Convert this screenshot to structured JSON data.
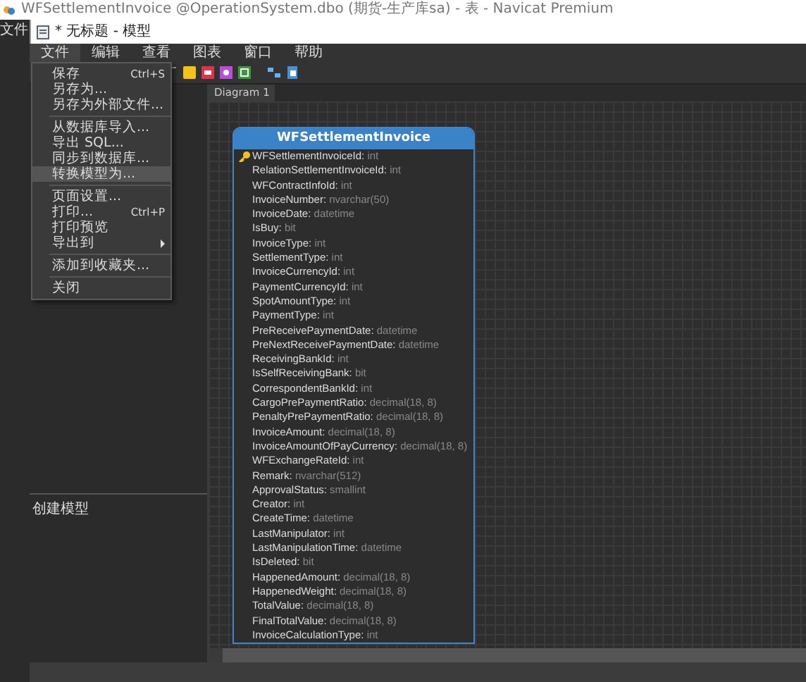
{
  "app_window": {
    "title": "WFSettlementInvoice @OperationSystem.dbo (期货-生产库sa) - 表 - Navicat Premium"
  },
  "side_strip": {
    "menu_label": "文件"
  },
  "document_window": {
    "title": "* 无标题 - 模型"
  },
  "menu_bar": [
    {
      "label": "文件",
      "selected": true
    },
    {
      "label": "编辑",
      "selected": false
    },
    {
      "label": "查看",
      "selected": false
    },
    {
      "label": "图表",
      "selected": false
    },
    {
      "label": "窗口",
      "selected": false
    },
    {
      "label": "帮助",
      "selected": false
    }
  ],
  "file_menu": [
    {
      "kind": "item",
      "label": "保存",
      "shortcut": "Ctrl+S",
      "submenu": false,
      "selected": false
    },
    {
      "kind": "item",
      "label": "另存为...",
      "submenu": false,
      "selected": false
    },
    {
      "kind": "item",
      "label": "另存为外部文件...",
      "submenu": false,
      "selected": false
    },
    {
      "kind": "separator"
    },
    {
      "kind": "item",
      "label": "从数据库导入...",
      "submenu": false,
      "selected": false
    },
    {
      "kind": "item",
      "label": "导出 SQL...",
      "submenu": false,
      "selected": false
    },
    {
      "kind": "item",
      "label": "同步到数据库...",
      "submenu": false,
      "selected": false
    },
    {
      "kind": "item",
      "label": "转换模型为...",
      "submenu": false,
      "selected": true
    },
    {
      "kind": "separator"
    },
    {
      "kind": "item",
      "label": "页面设置...",
      "submenu": false,
      "selected": false
    },
    {
      "kind": "item",
      "label": "打印...",
      "shortcut": "Ctrl+P",
      "submenu": false,
      "selected": false
    },
    {
      "kind": "item",
      "label": "打印预览",
      "submenu": false,
      "selected": false
    },
    {
      "kind": "item",
      "label": "导出到",
      "submenu": true,
      "selected": false
    },
    {
      "kind": "separator"
    },
    {
      "kind": "item",
      "label": "添加到收藏夹...",
      "submenu": false,
      "selected": false
    },
    {
      "kind": "separator"
    },
    {
      "kind": "item",
      "label": "关闭",
      "submenu": false,
      "selected": false
    }
  ],
  "left_panel": {
    "hint": "创建模型"
  },
  "diagram_tabs": [
    {
      "label": "Diagram 1",
      "selected": true
    }
  ],
  "entity": {
    "name": "WFSettlementInvoice",
    "separator": ":",
    "fields": [
      {
        "name": "WFSettlementInvoiceId",
        "type": "int",
        "primary_key": true
      },
      {
        "name": "RelationSettlementInvoiceId",
        "type": "int",
        "primary_key": false
      },
      {
        "name": "WFContractInfoId",
        "type": "int",
        "primary_key": false
      },
      {
        "name": "InvoiceNumber",
        "type": "nvarchar(50)",
        "primary_key": false
      },
      {
        "name": "InvoiceDate",
        "type": "datetime",
        "primary_key": false
      },
      {
        "name": "IsBuy",
        "type": "bit",
        "primary_key": false
      },
      {
        "name": "InvoiceType",
        "type": "int",
        "primary_key": false
      },
      {
        "name": "SettlementType",
        "type": "int",
        "primary_key": false
      },
      {
        "name": "InvoiceCurrencyId",
        "type": "int",
        "primary_key": false
      },
      {
        "name": "PaymentCurrencyId",
        "type": "int",
        "primary_key": false
      },
      {
        "name": "SpotAmountType",
        "type": "int",
        "primary_key": false
      },
      {
        "name": "PaymentType",
        "type": "int",
        "primary_key": false
      },
      {
        "name": "PreReceivePaymentDate",
        "type": "datetime",
        "primary_key": false
      },
      {
        "name": "PreNextReceivePaymentDate",
        "type": "datetime",
        "primary_key": false
      },
      {
        "name": "ReceivingBankId",
        "type": "int",
        "primary_key": false
      },
      {
        "name": "IsSelfReceivingBank",
        "type": "bit",
        "primary_key": false
      },
      {
        "name": "CorrespondentBankId",
        "type": "int",
        "primary_key": false
      },
      {
        "name": "CargoPrePaymentRatio",
        "type": "decimal(18, 8)",
        "primary_key": false
      },
      {
        "name": "PenaltyPrePaymentRatio",
        "type": "decimal(18, 8)",
        "primary_key": false
      },
      {
        "name": "InvoiceAmount",
        "type": "decimal(18, 8)",
        "primary_key": false
      },
      {
        "name": "InvoiceAmountOfPayCurrency",
        "type": "decimal(18, 8)",
        "primary_key": false
      },
      {
        "name": "WFExchangeRateId",
        "type": "int",
        "primary_key": false
      },
      {
        "name": "Remark",
        "type": "nvarchar(512)",
        "primary_key": false
      },
      {
        "name": "ApprovalStatus",
        "type": "smallint",
        "primary_key": false
      },
      {
        "name": "Creator",
        "type": "int",
        "primary_key": false
      },
      {
        "name": "CreateTime",
        "type": "datetime",
        "primary_key": false
      },
      {
        "name": "LastManipulator",
        "type": "int",
        "primary_key": false
      },
      {
        "name": "LastManipulationTime",
        "type": "datetime",
        "primary_key": false
      },
      {
        "name": "IsDeleted",
        "type": "bit",
        "primary_key": false
      },
      {
        "name": "HappenedAmount",
        "type": "decimal(18, 8)",
        "primary_key": false
      },
      {
        "name": "HappenedWeight",
        "type": "decimal(18, 8)",
        "primary_key": false
      },
      {
        "name": "TotalValue",
        "type": "decimal(18, 8)",
        "primary_key": false
      },
      {
        "name": "FinalTotalValue",
        "type": "decimal(18, 8)",
        "primary_key": false
      },
      {
        "name": "InvoiceCalculationType",
        "type": "int",
        "primary_key": false
      }
    ]
  }
}
